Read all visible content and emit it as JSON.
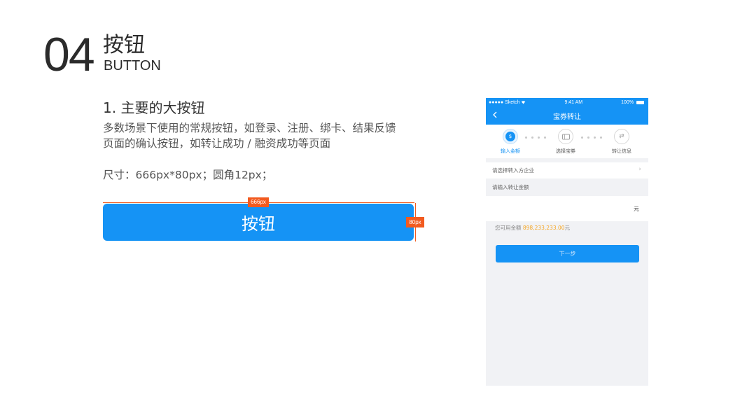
{
  "section": {
    "number": "04",
    "title_zh": "按钮",
    "title_en": "BUTTON"
  },
  "left": {
    "subtitle": "1.  主要的大按钮",
    "description_lines": [
      "多数场景下使用的常规按钮，如登录、注册、绑卡、结果反馈",
      "页面的确认按钮，如转让成功 / 融资成功等页面"
    ],
    "size_note": "尺寸：666px*80px；圆角12px；",
    "width_tag": "666px",
    "height_tag": "80px",
    "button_label": "按钮",
    "accent_color": "#1593f5",
    "dimension_color": "#f25a1f"
  },
  "phone": {
    "status": {
      "carrier": "●●●●● Sketch",
      "wifi_icon": "wifi-icon",
      "time": "9:41 AM",
      "battery": "100%"
    },
    "nav": {
      "back_icon": "chevron-left-icon",
      "title": "宝券转让"
    },
    "steps": [
      {
        "label": "输入金额",
        "icon": "money-bag-icon",
        "active": true
      },
      {
        "label": "选择宝券",
        "icon": "ticket-icon",
        "active": false
      },
      {
        "label": "转让信息",
        "icon": "exchange-icon",
        "active": false
      }
    ],
    "select_company": "请选择转入方企业",
    "amount_label": "请输入转让金额",
    "amount_unit": "元",
    "available_prefix": "您可用金额 ",
    "available_amount": "898,233,233.00",
    "available_suffix": "元",
    "next_button": "下一步",
    "highlight_color": "#f5a623"
  }
}
